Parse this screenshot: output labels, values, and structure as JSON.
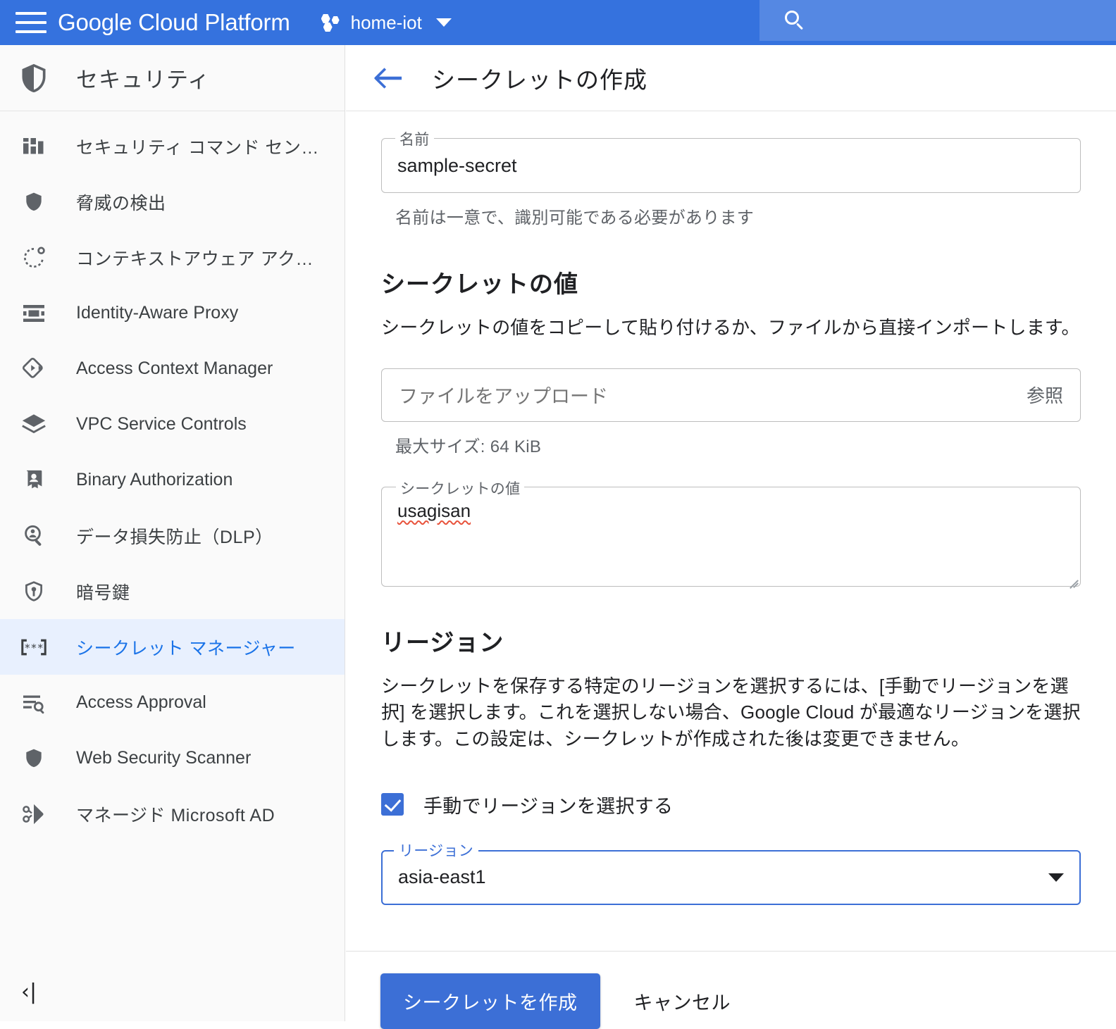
{
  "topbar": {
    "menu_icon": "hamburger-icon",
    "brand": "Google Cloud Platform",
    "project_icon": "project-hexagons-icon",
    "project_name": "home-iot",
    "project_caret": "chevron-down-icon",
    "search_icon": "search-icon",
    "search_value": "",
    "background_color": "#3572DE"
  },
  "sidebar": {
    "header_icon": "shield-icon",
    "header_title": "セキュリティ",
    "collapse_icon": "collapse-panel-icon",
    "selected_index": 9,
    "selected_color": "#1a73e8",
    "selected_bg": "#e8f0fe",
    "items": [
      {
        "label": "セキュリティ コマンド セン…",
        "icon": "dashboard-bars-icon"
      },
      {
        "label": "脅威の検出",
        "icon": "shield-small-icon"
      },
      {
        "label": "コンテキストアウェア アク…",
        "icon": "context-circle-icon"
      },
      {
        "label": "Identity-Aware Proxy",
        "icon": "proxy-icon"
      },
      {
        "label": "Access Context Manager",
        "icon": "diamond-arrow-icon"
      },
      {
        "label": "VPC Service Controls",
        "icon": "layers-diamond-icon"
      },
      {
        "label": "Binary Authorization",
        "icon": "badge-person-icon"
      },
      {
        "label": "データ損失防止（DLP）",
        "icon": "person-search-icon"
      },
      {
        "label": "暗号鍵",
        "icon": "shield-key-icon"
      },
      {
        "label": "シークレット マネージャー",
        "icon": "asterisk-brackets-icon"
      },
      {
        "label": "Access Approval",
        "icon": "list-search-icon"
      },
      {
        "label": "Web Security Scanner",
        "icon": "shield-icon"
      },
      {
        "label": "マネージド Microsoft AD",
        "icon": "active-directory-icon"
      }
    ]
  },
  "main": {
    "back_icon": "back-arrow-icon",
    "title": "シークレットの作成",
    "name_field": {
      "label": "名前",
      "value": "sample-secret",
      "hint": "名前は一意で、識別可能である必要があります"
    },
    "secret_value_section": {
      "heading": "シークレットの値",
      "description": "シークレットの値をコピーして貼り付けるか、ファイルから直接インポートします。",
      "upload_placeholder": "ファイルをアップロード",
      "browse_label": "参照",
      "size_hint": "最大サイズ: 64 KiB",
      "textarea_label": "シークレットの値",
      "textarea_value": "usagisan"
    },
    "region_section": {
      "heading": "リージョン",
      "description": "シークレットを保存する特定のリージョンを選択するには、[手動でリージョンを選択] を選択します。これを選択しない場合、Google Cloud が最適なリージョンを選択します。この設定は、シークレットが作成された後は変更できません。",
      "checkbox_label": "手動でリージョンを選択する",
      "checkbox_checked": "true",
      "select_label": "リージョン",
      "select_value": "asia-east1",
      "select_caret": "chevron-down-icon",
      "focus_color": "#3c6fd6"
    },
    "actions": {
      "primary_label": "シークレットを作成",
      "cancel_label": "キャンセル",
      "primary_color": "#3c6fd6"
    }
  }
}
